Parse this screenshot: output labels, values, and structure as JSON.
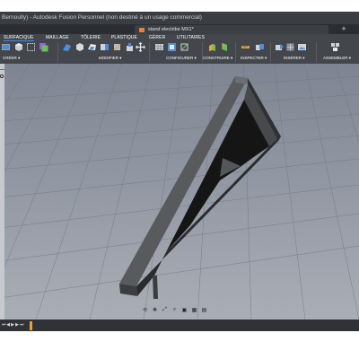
{
  "window": {
    "title": "Bernoully) - Autodesk Fusion Personnel (non destiné à un usage commercial)"
  },
  "doc_tab": {
    "title": "stand electribe MX1*"
  },
  "ribbon": {
    "tabs": [
      "SURFACIQUE",
      "MAILLAGE",
      "TÔLERIE",
      "PLASTIQUE",
      "GÉRER",
      "UTILITAIRES"
    ],
    "groups": [
      "CRÉER ▾",
      "MODIFIER ▾",
      "CONFIGURER ▾",
      "CONSTRUIRE ▾",
      "INSPECTER ▾",
      "INSÉRER ▾",
      "ASSEMBLER ▾"
    ]
  },
  "colors": {
    "title_bar": "#3a3d42",
    "ribbon": "#43474c",
    "viewport_top": "#7e8592",
    "viewport_bottom": "#a9aeb6",
    "part_dark": "#2c2d2f",
    "part_face": "#4e4f52",
    "active_tab": "#3f8de6",
    "doc_tab_icon": "#f07f2e"
  },
  "navigation_bar": {
    "icons": [
      "orbit-icon",
      "pan-icon",
      "fit-icon",
      "zoom-icon",
      "display-icon",
      "grid-icon",
      "layout-icon"
    ]
  },
  "timeline": {
    "icons": [
      "first-icon",
      "prev-icon",
      "play-icon",
      "next-icon",
      "last-icon"
    ]
  }
}
